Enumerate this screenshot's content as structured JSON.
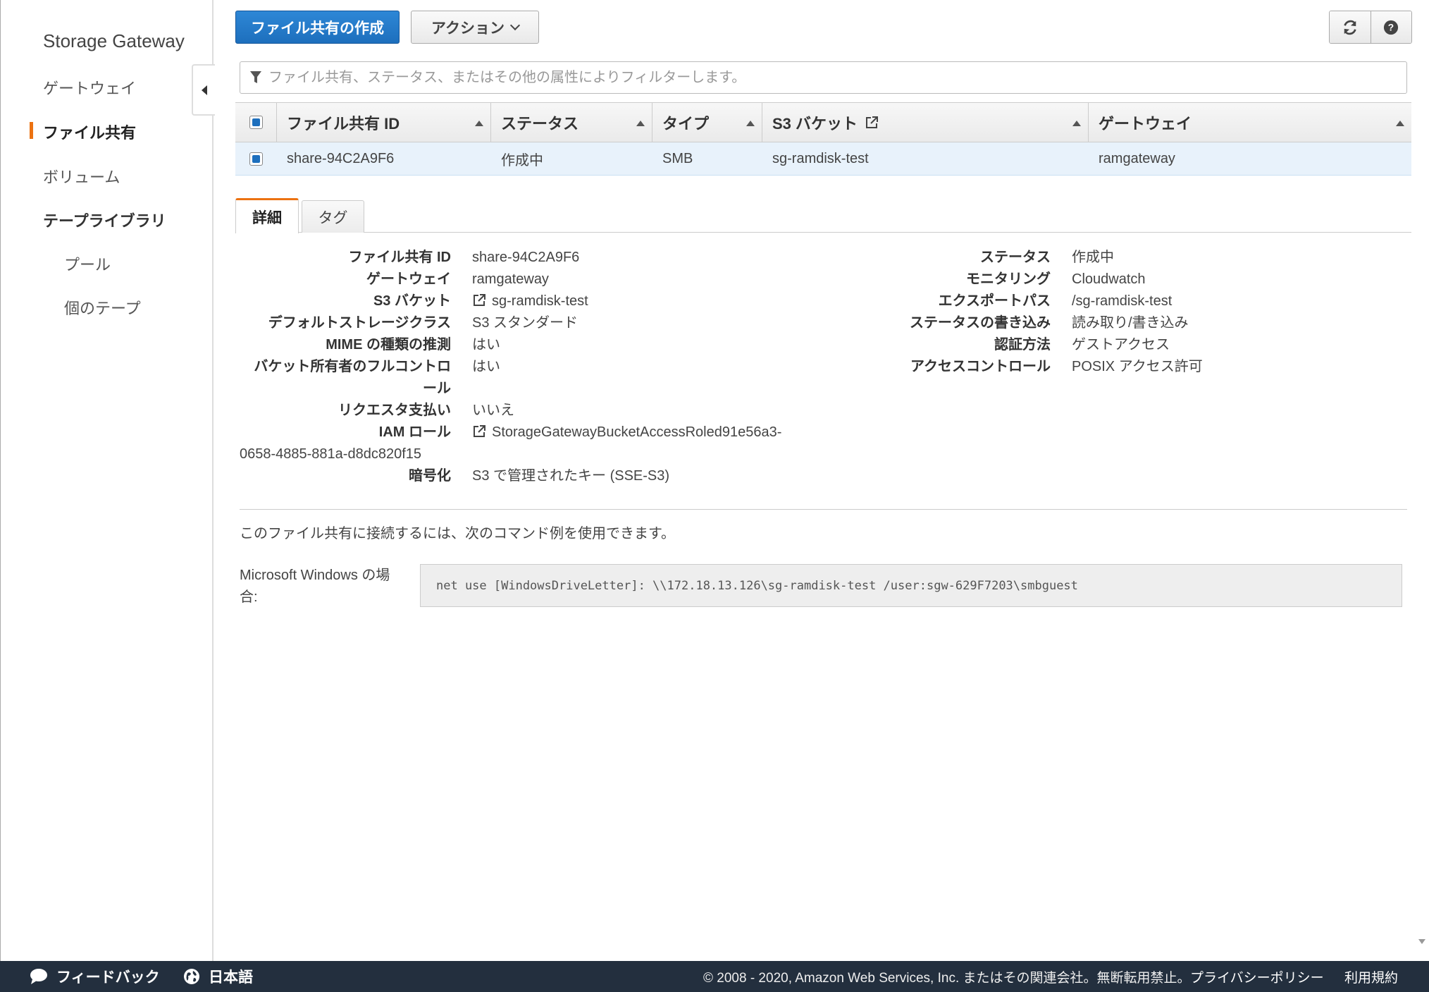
{
  "sidebar": {
    "service_title": "Storage Gateway",
    "items": [
      {
        "label": "ゲートウェイ"
      },
      {
        "label": "ファイル共有"
      },
      {
        "label": "ボリューム"
      },
      {
        "label": "テープライブラリ"
      },
      {
        "label": "プール"
      },
      {
        "label": "個のテープ"
      }
    ],
    "active_color": "#ec7211"
  },
  "toolbar": {
    "create_label": "ファイル共有の作成",
    "actions_label": "アクション",
    "refresh_icon": "refresh-icon",
    "help_icon": "help-icon"
  },
  "filter": {
    "placeholder": "ファイル共有、ステータス、またはその他の属性によりフィルターします。"
  },
  "table": {
    "headers": [
      "ファイル共有 ID",
      "ステータス",
      "タイプ",
      "S3 バケット",
      "ゲートウェイ"
    ],
    "rows": [
      {
        "id": "share-94C2A9F6",
        "status": "作成中",
        "type": "SMB",
        "bucket": "sg-ramdisk-test",
        "gateway": "ramgateway"
      }
    ]
  },
  "tabs": [
    {
      "label": "詳細"
    },
    {
      "label": "タグ"
    }
  ],
  "details": {
    "left": [
      {
        "label": "ファイル共有 ID",
        "value": "share-94C2A9F6"
      },
      {
        "label": "ゲートウェイ",
        "value": "ramgateway"
      },
      {
        "label": "S3 バケット",
        "value": "sg-ramdisk-test"
      },
      {
        "label": "デフォルトストレージクラス",
        "value": "S3 スタンダード"
      },
      {
        "label": "MIME の種類の推測",
        "value": "はい"
      },
      {
        "label": "バケット所有者のフルコントロ",
        "label_cont": "ール",
        "value": "はい"
      },
      {
        "label": "リクエスタ支払い",
        "value": "いいえ"
      },
      {
        "label": "IAM ロール",
        "value": "StorageGatewayBucketAccessRoled91e56a3-",
        "value_cont": "0658-4885-881a-d8dc820f15"
      },
      {
        "label": "暗号化",
        "value": "S3 で管理されたキー (SSE-S3)"
      }
    ],
    "right": [
      {
        "label": "ステータス",
        "value": "作成中"
      },
      {
        "label": "モニタリング",
        "value": "Cloudwatch"
      },
      {
        "label": "エクスポートパス",
        "value": "/sg-ramdisk-test"
      },
      {
        "label": "ステータスの書き込み",
        "value": "読み取り/書き込み"
      },
      {
        "label": "認証方法",
        "value": "ゲストアクセス"
      },
      {
        "label": "アクセスコントロール",
        "value": "POSIX アクセス許可"
      }
    ]
  },
  "connect": {
    "hint": "このファイル共有に接続するには、次のコマンド例を使用できます。",
    "windows_label": "Microsoft Windows の場合:",
    "command": "net use [WindowsDriveLetter]: \\\\172.18.13.126\\sg-ramdisk-test /user:sgw-629F7203\\smbguest"
  },
  "footer": {
    "feedback": "フィードバック",
    "language": "日本語",
    "copyright": "© 2008 - 2020, Amazon Web Services, Inc. またはその関連会社。無断転用禁止。",
    "privacy": "プライバシーポリシー",
    "terms": "利用規約"
  }
}
